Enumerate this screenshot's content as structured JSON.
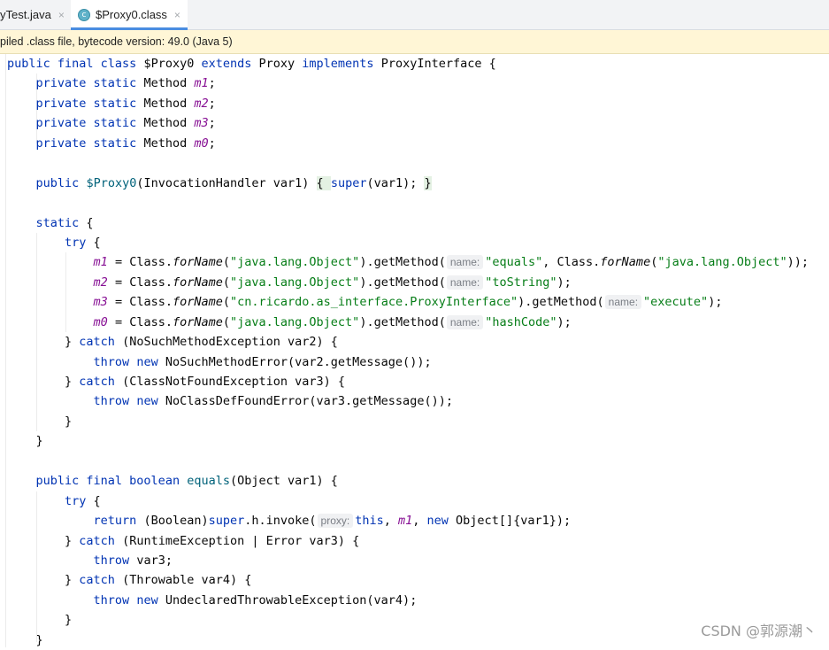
{
  "tabs": [
    {
      "label": "yTest.java",
      "close": "×"
    },
    {
      "label": "$Proxy0.class",
      "close": "×",
      "icon": "class-file-icon"
    }
  ],
  "notice": "piled .class file, bytecode version: 49.0 (Java 5)",
  "code": {
    "l1_kw1": "public final class",
    "l1_name": " $Proxy0 ",
    "l1_kw2": "extends",
    "l1_p": " Proxy ",
    "l1_kw3": "implements",
    "l1_i": " ProxyInterface {",
    "kw_psm": "private static",
    "type_method": " Method ",
    "semi": ";",
    "m1": "m1",
    "m2": "m2",
    "m3": "m3",
    "m0": "m0",
    "ctor_kw": "public",
    "ctor_name": "$Proxy0",
    "ctor_params": "(InvocationHandler var1) ",
    "ctor_body_open": "{ ",
    "kw_super": "super",
    "ctor_call": "(var1); ",
    "ctor_body_close": "}",
    "kw_static": "static",
    "open_brace": " {",
    "kw_try": "try",
    "assign": " = Class.",
    "forName": "forName",
    "get_method": ").getMethod(",
    "hint_name": "name:",
    "hint_proxy": "proxy:",
    "str_object": "\"java.lang.Object\"",
    "str_equals": "\"equals\"",
    "str_tostring": "\"toString\"",
    "str_proxy_iface": "\"cn.ricardo.as_interface.ProxyInterface\"",
    "str_execute": "\"execute\"",
    "str_hashcode": "\"hashCode\"",
    "comma_class": ", Class.",
    "close_call2": "));",
    "close_call1": ");",
    "close_call1p": ")",
    "close_brace": "}",
    "close_brace_sp": "} ",
    "kw_catch": "catch",
    "catch_nsme": " (NoSuchMethodException var2) {",
    "kw_throw": "throw",
    "kw_new": "new",
    "throw_nsme": " NoSuchMethodError(var2.getMessage());",
    "catch_cnfe": " (ClassNotFoundException var3) {",
    "throw_ncdf": " NoClassDefFoundError(var3.getMessage());",
    "kw_pfb": "public final boolean",
    "equals_name": "equals",
    "equals_params": "(Object var1) {",
    "kw_return": "return",
    "ret_cast": " (Boolean)",
    "ret_h": ".h.invoke(",
    "kw_this": "this",
    "comma_sp": ", ",
    "ret_tail": " Object[]{var1});",
    "catch_rt": " (RuntimeException | Error var3) {",
    "throw_var3": " var3;",
    "catch_thr": " (Throwable var4) {",
    "throw_ute": " UndeclaredThrowableException(var4);"
  },
  "watermark": "CSDN @郭源潮丶"
}
